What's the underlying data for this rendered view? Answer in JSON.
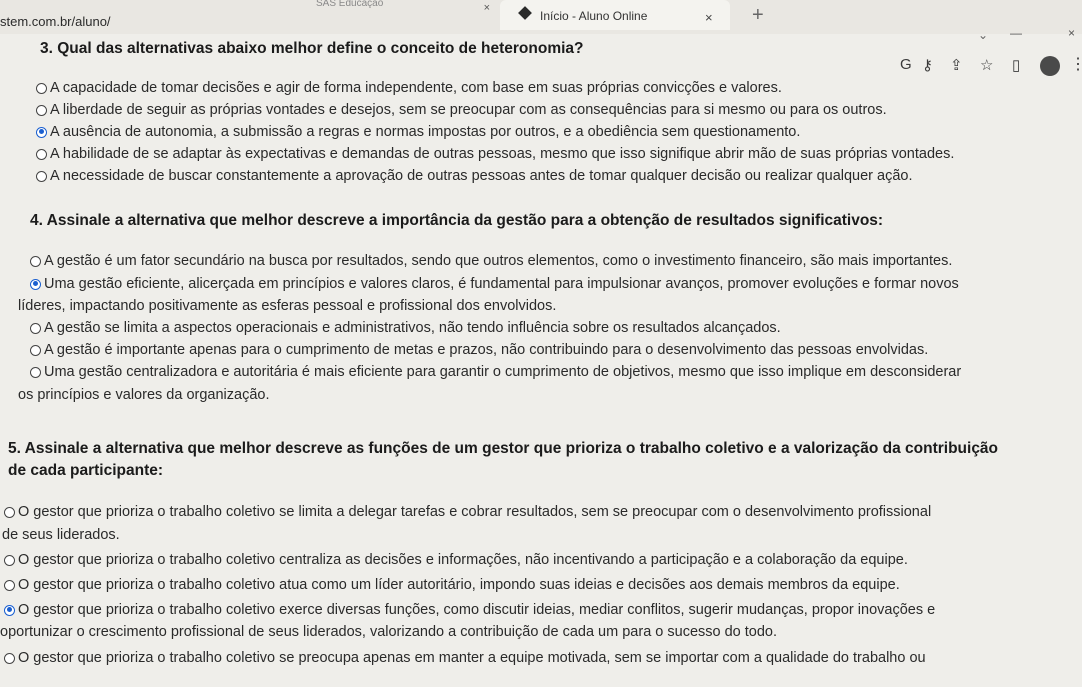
{
  "browser": {
    "inactive_tab_title": "SAS Educação",
    "active_tab_title": "Início - Aluno Online",
    "tab_close": "×",
    "new_tab": "+",
    "url": "stem.com.br/aluno/"
  },
  "questions": [
    {
      "title": "3. Qual das alternativas abaixo melhor define o conceito de heteronomia?",
      "options": [
        {
          "text": "A capacidade de tomar decisões e agir de forma independente, com base em suas próprias convicções e valores.",
          "selected": false
        },
        {
          "text": "A liberdade de seguir as próprias vontades e desejos, sem se preocupar com as consequências para si mesmo ou para os outros.",
          "selected": false
        },
        {
          "text": "A ausência de autonomia, a submissão a regras e normas impostas por outros, e a obediência sem questionamento.",
          "selected": true
        },
        {
          "text": "A habilidade de se adaptar às expectativas e demandas de outras pessoas, mesmo que isso signifique abrir mão de suas próprias vontades.",
          "selected": false
        },
        {
          "text": "A necessidade de buscar constantemente a aprovação de outras pessoas antes de tomar qualquer decisão ou realizar qualquer ação.",
          "selected": false
        }
      ]
    },
    {
      "title": "4. Assinale a alternativa que melhor descreve a importância da gestão para a obtenção de resultados significativos:",
      "options": [
        {
          "text": "A gestão é um fator secundário na busca por resultados, sendo que outros elementos, como o investimento financeiro, são mais importantes.",
          "selected": false
        },
        {
          "text": "Uma gestão eficiente, alicerçada em princípios e valores claros, é fundamental para impulsionar avanços, promover evoluções e formar novos",
          "cont": "líderes, impactando positivamente as esferas pessoal e profissional dos envolvidos.",
          "selected": true
        },
        {
          "text": "A gestão se limita a aspectos operacionais e administrativos, não tendo influência sobre os resultados alcançados.",
          "selected": false
        },
        {
          "text": "A gestão é importante apenas para o cumprimento de metas e prazos, não contribuindo para o desenvolvimento das pessoas envolvidas.",
          "selected": false
        },
        {
          "text": "Uma gestão centralizadora e autoritária é mais eficiente para garantir o cumprimento de objetivos, mesmo que isso implique em desconsiderar",
          "cont": "os princípios e valores da organização.",
          "selected": false
        }
      ]
    },
    {
      "title": "5. Assinale a alternativa que melhor descreve as funções de um gestor que prioriza o trabalho coletivo e a valorização da contribuição",
      "title_cont": "de cada participante:",
      "options": [
        {
          "text": "O gestor que prioriza o trabalho coletivo se limita a delegar tarefas e cobrar resultados, sem se preocupar com o desenvolvimento profissional",
          "cont": "de seus liderados.",
          "selected": false
        },
        {
          "text": "O gestor que prioriza o trabalho coletivo centraliza as decisões e informações, não incentivando a participação e a colaboração da equipe.",
          "selected": false
        },
        {
          "text": "O gestor que prioriza o trabalho coletivo atua como um líder autoritário, impondo suas ideias e decisões aos demais membros da equipe.",
          "selected": false
        },
        {
          "text": "O gestor que prioriza o trabalho coletivo exerce diversas funções, como discutir ideias, mediar conflitos, sugerir mudanças, propor inovações e",
          "cont": "oportunizar o crescimento profissional de seus liderados, valorizando a contribuição de cada um para o sucesso do todo.",
          "selected": true
        },
        {
          "text": "O gestor que prioriza o trabalho coletivo se preocupa apenas em manter a equipe motivada, sem se importar com a qualidade do trabalho ou",
          "selected": false
        }
      ]
    }
  ]
}
